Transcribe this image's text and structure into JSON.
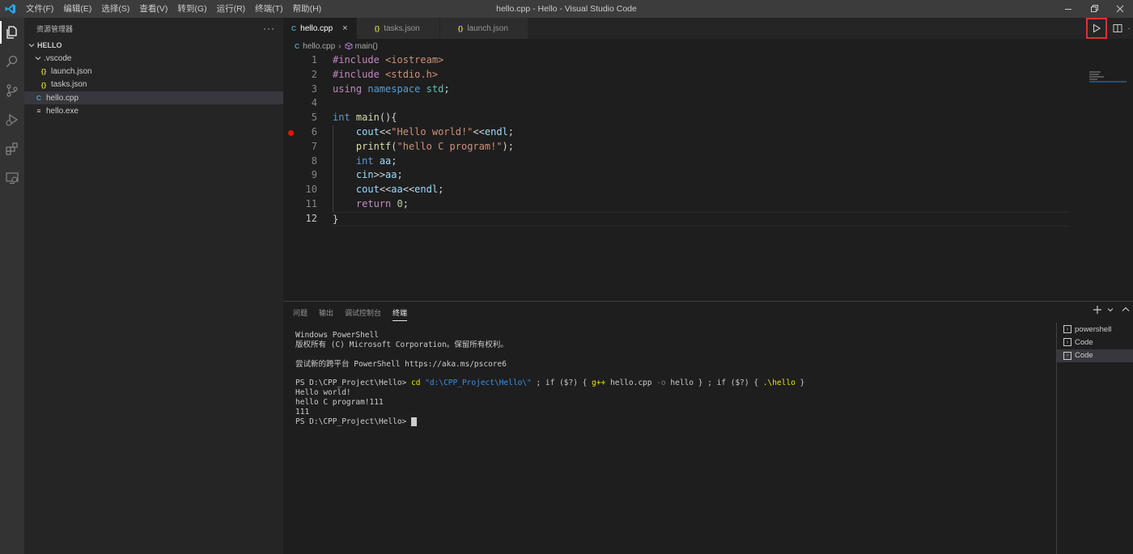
{
  "titlebar": {
    "menu": [
      "文件(F)",
      "编辑(E)",
      "选择(S)",
      "查看(V)",
      "转到(G)",
      "运行(R)",
      "终端(T)",
      "帮助(H)"
    ],
    "window_title": "hello.cpp - Hello - Visual Studio Code"
  },
  "sidebar": {
    "header": "资源管理器",
    "more": "···",
    "section": "HELLO",
    "tree": [
      {
        "label": ".vscode",
        "type": "folder",
        "expanded": true
      },
      {
        "label": "launch.json",
        "type": "json",
        "icon": "{}"
      },
      {
        "label": "tasks.json",
        "type": "json",
        "icon": "{}"
      },
      {
        "label": "hello.cpp",
        "type": "cpp",
        "icon": "C"
      },
      {
        "label": "hello.exe",
        "type": "exe",
        "icon": "≡"
      }
    ]
  },
  "editor": {
    "tabs": [
      {
        "label": "hello.cpp",
        "icon": "C",
        "active": true
      },
      {
        "label": "tasks.json",
        "icon": "{}",
        "active": false
      },
      {
        "label": "launch.json",
        "icon": "{}",
        "active": false
      }
    ],
    "tab_close": "×",
    "breadcrumb": {
      "file": "hello.cpp",
      "symbol": "main()"
    },
    "line_numbers": [
      "1",
      "2",
      "3",
      "4",
      "5",
      "6",
      "7",
      "8",
      "9",
      "10",
      "11",
      "12"
    ],
    "breakpoint_line": 6,
    "current_line": 12
  },
  "panel": {
    "tabs": [
      "问题",
      "输出",
      "调试控制台",
      "终端"
    ],
    "active_tab": "终端",
    "terminal_lines": {
      "l1": "Windows PowerShell",
      "l2": "版权所有 (C) Microsoft Corporation。保留所有权利。",
      "l3": "尝试新的跨平台 PowerShell https://aka.ms/pscore6",
      "prompt": "PS D:\\CPP_Project\\Hello> ",
      "cmd_cd": "cd",
      "cmd_path": "\"d:\\CPP_Project\\Hello\\\"",
      "cmd_sep1": " ; if ($?) { ",
      "cmd_gpp": "g++",
      "cmd_file": " hello.cpp ",
      "cmd_o": "-o",
      "cmd_out": " hello } ; if ($?) { ",
      "cmd_run": ".\\hello",
      "cmd_end": " }",
      "out1": "Hello world!",
      "out2": "hello C program!111",
      "out3": "111",
      "prompt2": "PS D:\\CPP_Project\\Hello> "
    },
    "terminals": [
      "powershell",
      "Code",
      "Code"
    ],
    "selected_terminal": 2
  },
  "colors": {
    "accent_highlight": "#e0312c",
    "breakpoint": "#e51400"
  }
}
